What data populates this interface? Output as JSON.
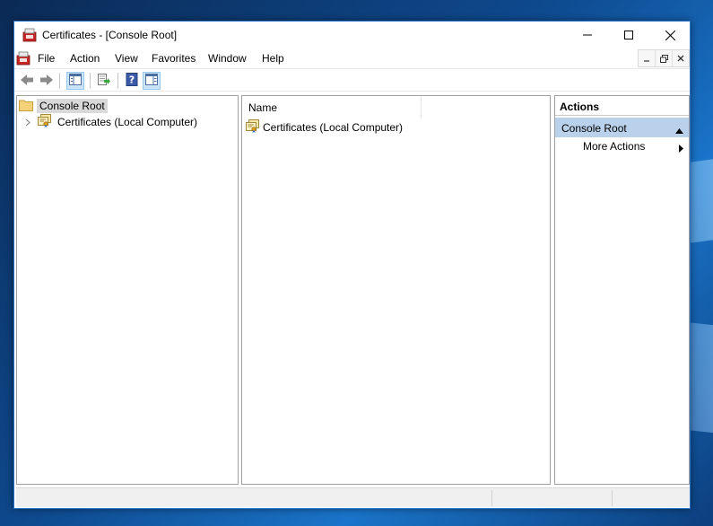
{
  "window": {
    "title": "Certificates - [Console Root]"
  },
  "menubar": {
    "items": [
      "File",
      "Action",
      "View",
      "Favorites",
      "Window",
      "Help"
    ]
  },
  "toolbar": {
    "buttons": [
      "back-arrow-icon",
      "forward-arrow-icon",
      "show-hide-console-tree-icon",
      "export-list-icon",
      "help-icon",
      "show-hide-action-pane-icon"
    ]
  },
  "tree": {
    "root": "Console Root",
    "child": "Certificates (Local Computer)"
  },
  "list": {
    "column_name": "Name",
    "rows": [
      "Certificates (Local Computer)"
    ]
  },
  "actions": {
    "title": "Actions",
    "group": "Console Root",
    "item": "More Actions"
  },
  "colors": {
    "accent_border": "#2b74c7",
    "actions_group_bg": "#b9d1ea",
    "selection_bg": "#d9d9d9"
  }
}
